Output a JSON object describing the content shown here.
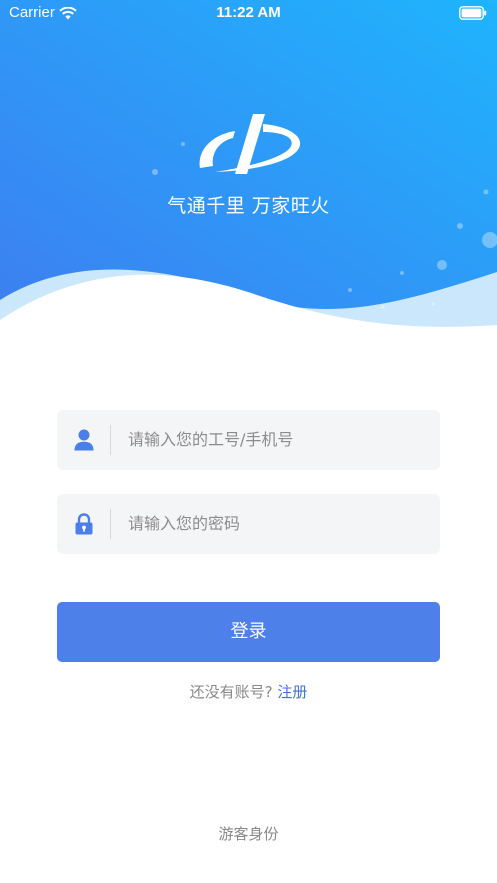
{
  "status_bar": {
    "carrier": "Carrier",
    "time": "11:22 AM",
    "icons": [
      "wifi-icon",
      "battery-icon"
    ]
  },
  "brand": {
    "logo_icon": "brand-logo",
    "slogan": "气通千里 万家旺火"
  },
  "form": {
    "username": {
      "icon": "user-icon",
      "placeholder": "请输入您的工号/手机号"
    },
    "password": {
      "icon": "lock-icon",
      "placeholder": "请输入您的密码"
    },
    "login_label": "登录"
  },
  "register": {
    "prompt": "还没有账号?",
    "link_label": "注册"
  },
  "guest_label": "游客身份",
  "colors": {
    "gradient_start": "#1fb4fd",
    "gradient_end": "#3e7df0",
    "accent": "#4e80ea",
    "link": "#3f73d8",
    "field_bg": "#f4f5f7",
    "placeholder": "#8c8c8c",
    "icon": "#4a7ee8"
  }
}
